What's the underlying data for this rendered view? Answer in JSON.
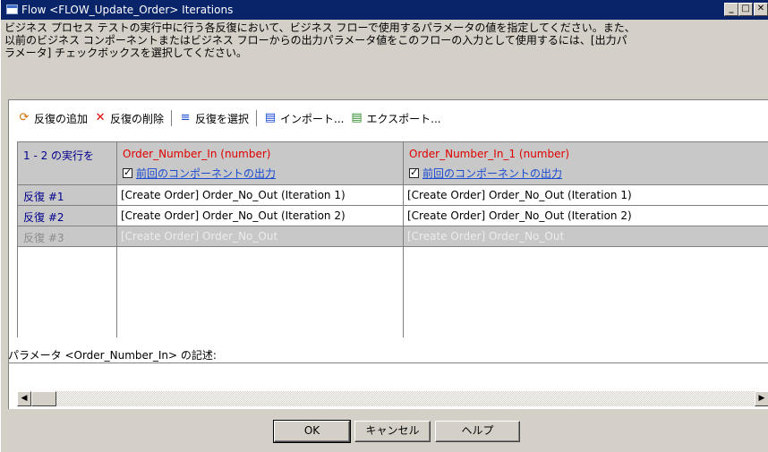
{
  "window": {
    "title": "Flow <FLOW_Update_Order> Iterations",
    "minimize": "_",
    "maximize": "□",
    "close": "✕"
  },
  "description": "ビジネス プロセス テストの実行中に行う各反復において、ビジネス フローで使用するパラメータの値を指定してください。また、\n以前のビジネス コンポーネントまたはビジネス フローからの出力パラメータ値をこのフローの入力として使用するには、[出力パ\nラメータ] チェックボックスを選択してください。",
  "toolbar": {
    "add": "反復の追加",
    "delete": "反復の削除",
    "select": "反復を選択",
    "import": "インポート...",
    "export": "エクスポート..."
  },
  "grid": {
    "corner": "1 - 2 の実行を",
    "columns": [
      {
        "name": "Order_Number_In (number)",
        "check_label": "前回のコンポーネントの出力",
        "checked": true
      },
      {
        "name": "Order_Number_In_1 (number)",
        "check_label": "前回のコンポーネントの出力",
        "checked": true
      }
    ],
    "rows": [
      {
        "label": "反復 #1",
        "cells": [
          "[Create Order] Order_No_Out (Iteration 1)",
          "[Create Order] Order_No_Out (Iteration 1)"
        ],
        "disabled": false
      },
      {
        "label": "反復 #2",
        "cells": [
          "[Create Order] Order_No_Out (Iteration 2)",
          "[Create Order] Order_No_Out (Iteration 2)"
        ],
        "disabled": false
      },
      {
        "label": "反復 #3",
        "cells": [
          "[Create Order] Order_No_Out",
          "[Create Order] Order_No_Out"
        ],
        "disabled": true
      }
    ]
  },
  "param_description_label": "パラメータ <Order_Number_In> の記述:",
  "buttons": {
    "ok": "OK",
    "cancel": "キャンセル",
    "help": "ヘルプ"
  },
  "colors": {
    "titlebar": "#0a246a",
    "header_name": "#e00000",
    "link": "#1a4bd1",
    "row_label": "#00008b"
  }
}
